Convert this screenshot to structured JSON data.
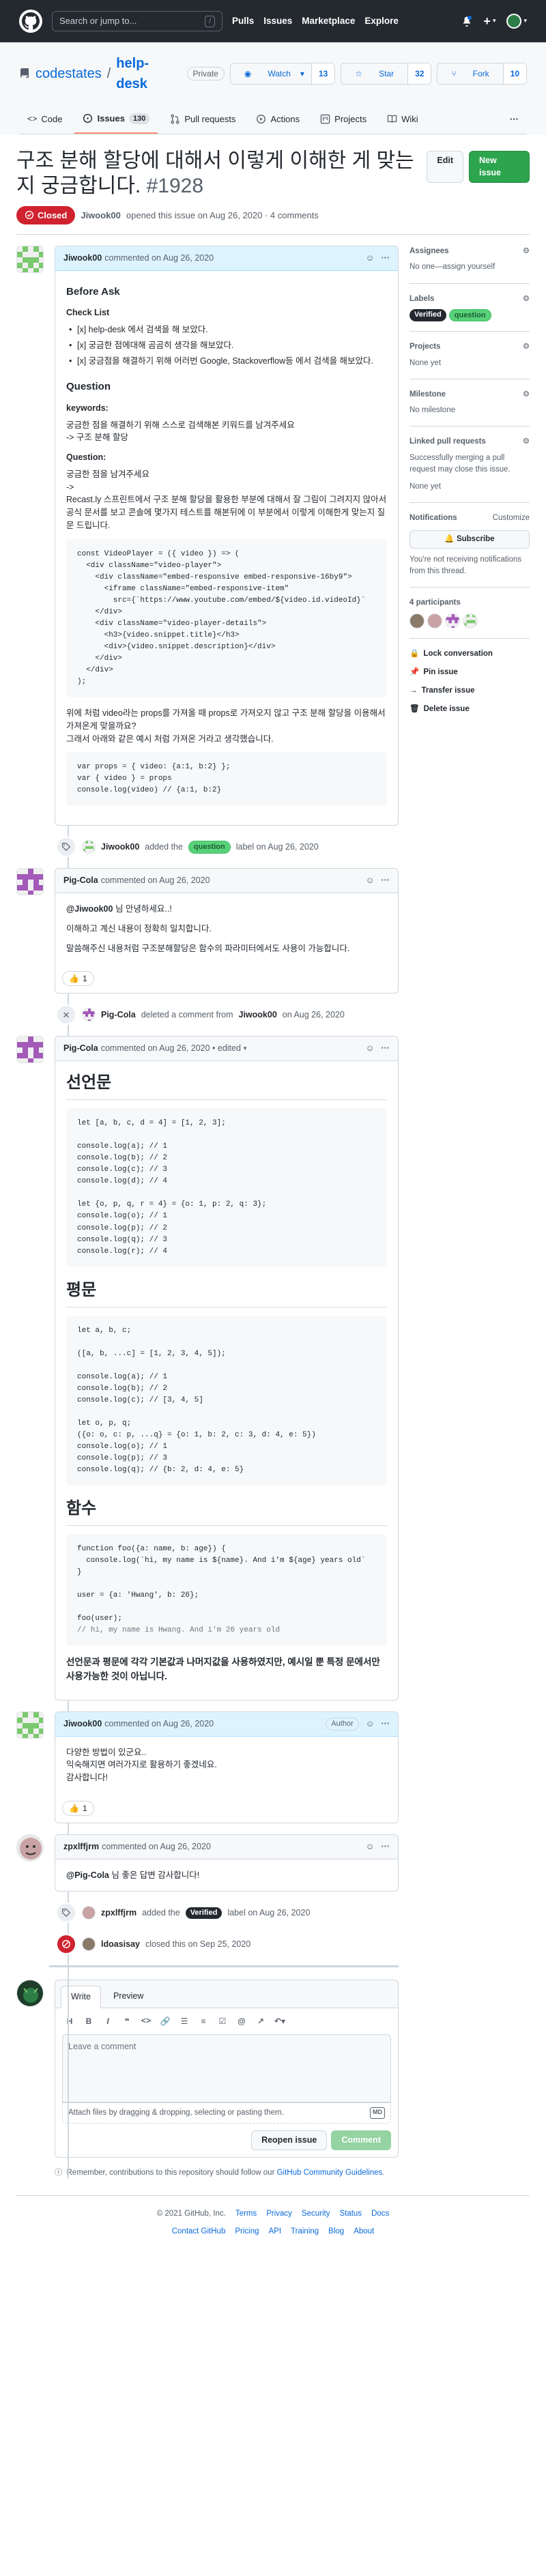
{
  "header": {
    "search_placeholder": "Search or jump to...",
    "search_key": "/",
    "nav": [
      "Pulls",
      "Issues",
      "Marketplace",
      "Explore"
    ]
  },
  "repo": {
    "owner": "codestates",
    "name": "help-desk",
    "visibility": "Private",
    "watch": {
      "label": "Watch",
      "count": "13"
    },
    "star": {
      "label": "Star",
      "count": "32"
    },
    "fork": {
      "label": "Fork",
      "count": "10"
    },
    "tabs": [
      {
        "label": "Code"
      },
      {
        "label": "Issues",
        "count": "130"
      },
      {
        "label": "Pull requests"
      },
      {
        "label": "Actions"
      },
      {
        "label": "Projects"
      },
      {
        "label": "Wiki"
      }
    ]
  },
  "issue": {
    "title": "구조 분해 할당에 대해서 이렇게 이해한 게 맞는지 궁금합니다.",
    "number": "#1928",
    "edit_label": "Edit",
    "new_label": "New issue",
    "state": "Closed",
    "meta": {
      "author": "Jiwook00",
      "text": "opened this issue on Aug 26, 2020 · 4 comments"
    }
  },
  "comments": {
    "c1": {
      "author": "Jiwook00",
      "meta": "commented on Aug 26, 2020",
      "h_before": "Before Ask",
      "h_check": "Check List",
      "checks": [
        "[x] help-desk 에서 검색을 해 보았다.",
        "[x] 궁금한 점에대해 곰곰히 생각을 해보았다.",
        "[x] 궁금점을 해결하기 위해 어러번 Google, Stackoverflow등 에서 검색을 해보았다."
      ],
      "h_question": "Question",
      "keywords_label": "keywords:",
      "keywords_text": "궁금한 점을 해결하기 위해 스스로 검색해본 키워드를 남겨주세요",
      "keywords_value": "-> 구조 분해 할당",
      "question_label": "Question:",
      "question_text": "궁금한 점을 남겨주세요",
      "question_arrow": "->",
      "question_body": "Recast.ly 스프린트에서 구조 분해 할당을 활용한 부분에 대해서 잘 그림이 그려지지 않아서 공식 문서를 보고 콘솔에 몇가지 테스트를 해본뒤에 이 부분에서 이렇게 이해한게 맞는지 질문 드립니다.",
      "code1": [
        "const VideoPlayer = ({ video }) => (",
        "  <div className=\"video-player\">",
        "    <div className=\"embed-responsive embed-responsive-16by9\">",
        "      <iframe className=\"embed-responsive-item\"",
        "        src={`https://www.youtube.com/embed/${video.id.videoId}`",
        "    </div>",
        "    <div className=\"video-player-details\">",
        "      <h3>{video.snippet.title}</h3>",
        "      <div>{video.snippet.description}</div>",
        "    </div>",
        "  </div>",
        ");"
      ],
      "para2": "위에 처럼 video라는 props를 가져올 때 props로 가져오지 않고 구조 분해 할당을 이용해서 가져온게 맞을까요?",
      "para3": "그래서 아래와 같은 예시 처럼 가져온 거라고 생각했습니다.",
      "code2": [
        "var props = { video: {a:1, b:2} };",
        "var { video } = props",
        "console.log(video) // {a:1, b:2}"
      ]
    },
    "ev1": {
      "user": "Jiwook00",
      "text_before": "added the",
      "label": "question",
      "text_after": "label on Aug 26, 2020"
    },
    "c2": {
      "author": "Pig-Cola",
      "meta": "commented on Aug 26, 2020",
      "mention": "@Jiwook00",
      "line1": " 님 안녕하세요..!",
      "line2": "이해하고 계신 내용이 정확히 일치합니다.",
      "line3": "말씀해주신 내용처럼 구조분해할당은 함수의 파라미터에서도 사용이 가능합니다.",
      "reaction": "1"
    },
    "ev2": {
      "user": "Pig-Cola",
      "text_before": "deleted a comment from",
      "target": "Jiwook00",
      "text_after": "on Aug 26, 2020"
    },
    "c3": {
      "author": "Pig-Cola",
      "meta": "commented on Aug 26, 2020 • edited",
      "h1": "선언문",
      "code1": [
        "let [a, b, c, d = 4] = [1, 2, 3];",
        "",
        "console.log(a); // 1",
        "console.log(b); // 2",
        "console.log(c); // 3",
        "console.log(d); // 4",
        "",
        "let {o, p, q, r = 4} = {o: 1, p: 2, q: 3};",
        "console.log(o); // 1",
        "console.log(p); // 2",
        "console.log(q); // 3",
        "console.log(r); // 4"
      ],
      "h2": "평문",
      "code2": [
        "let a, b, c;",
        "",
        "([a, b, ...c] = [1, 2, 3, 4, 5]);",
        "",
        "console.log(a); // 1",
        "console.log(b); // 2",
        "console.log(c); // [3, 4, 5]",
        "",
        "let o, p, q;",
        "({o: o, c: p, ...q} = {o: 1, b: 2, c: 3, d: 4, e: 5})",
        "console.log(o); // 1",
        "console.log(p); // 3",
        "console.log(q); // {b: 2, d: 4, e: 5}"
      ],
      "h3": "함수",
      "code3": [
        "function foo({a: name, b: age}) {",
        "  console.log(`hi, my name is ${name}. And i'm ${age} years old`",
        "}",
        "",
        "user = {a: 'Hwang', b: 26};",
        "",
        "foo(user);",
        "// hi, my name is Hwang. And i'm 26 years old"
      ],
      "summary": "선언문과 평문에 각각 기본값과 나머지값을 사용하였지만, 예시일 뿐 특정 문에서만 사용가능한 것이 아닙니다."
    },
    "c4": {
      "author": "Jiwook00",
      "meta": "commented on Aug 26, 2020",
      "badge": "Author",
      "line1": "다양한 방법이 있군요..",
      "line2": "익숙해지면 여러가지로 활용하기 좋겠네요.",
      "line3": "감사합니다!",
      "reaction": "1"
    },
    "c5": {
      "author": "zpxlffjrm",
      "meta": "commented on Aug 26, 2020",
      "mention": "@Pig-Cola",
      "text": " 님 좋은 답변 감사합니다!"
    },
    "ev3": {
      "user": "zpxlffjrm",
      "text_before": "added the",
      "label": "Verified",
      "text_after": "label on Aug 26, 2020"
    },
    "ev4": {
      "user": "ldoasisay",
      "text": "closed this on Sep 25, 2020"
    }
  },
  "composer": {
    "tab_write": "Write",
    "tab_preview": "Preview",
    "placeholder": "Leave a comment",
    "attach": "Attach files by dragging & dropping, selecting or pasting them.",
    "md": "MD",
    "reopen": "Reopen issue",
    "comment": "Comment",
    "notice_before": "Remember, contributions to this repository should follow our",
    "notice_link": "GitHub Community Guidelines",
    "notice_after": "."
  },
  "sidebar": {
    "assignees": {
      "title": "Assignees",
      "value": "No one—assign yourself"
    },
    "labels": {
      "title": "Labels",
      "items": [
        "Verified",
        "question"
      ]
    },
    "projects": {
      "title": "Projects",
      "value": "None yet"
    },
    "milestone": {
      "title": "Milestone",
      "value": "No milestone"
    },
    "linked": {
      "title": "Linked pull requests",
      "value": "Successfully merging a pull request may close this issue.",
      "none": "None yet"
    },
    "notifications": {
      "title": "Notifications",
      "customize": "Customize",
      "subscribe": "Subscribe",
      "note": "You're not receiving notifications from this thread."
    },
    "participants": {
      "title": "4 participants"
    },
    "actions": [
      "Lock conversation",
      "Pin issue",
      "Transfer issue",
      "Delete issue"
    ]
  },
  "footer": {
    "copyright": "© 2021 GitHub, Inc.",
    "links1": [
      "Terms",
      "Privacy",
      "Security",
      "Status",
      "Docs"
    ],
    "links2": [
      "Contact GitHub",
      "Pricing",
      "API",
      "Training",
      "Blog",
      "About"
    ]
  },
  "colors": {
    "accent": "#0969da",
    "closed": "#cf222e",
    "green": "#2da44e",
    "question": "#59d179"
  }
}
